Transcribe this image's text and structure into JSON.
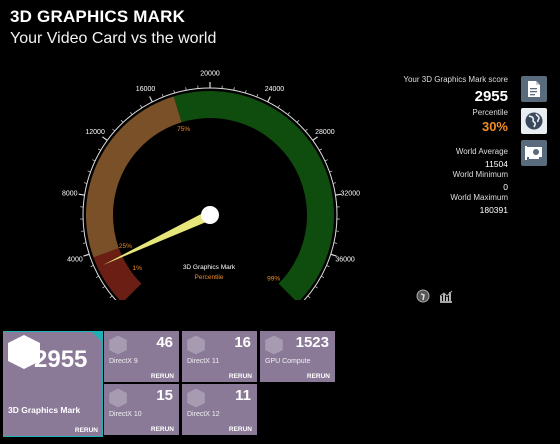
{
  "header": {
    "title": "3D GRAPHICS MARK",
    "subtitle": "Your Video Card vs the world"
  },
  "gauge": {
    "scale_labels": [
      "0",
      "4000",
      "8000",
      "12000",
      "16000",
      "20000",
      "24000",
      "28000",
      "32000",
      "36000",
      "40000"
    ],
    "scale_max": 40000,
    "score_value": 2955,
    "needle_value": 2955,
    "percentile_markers": [
      "1%",
      "25%",
      "75%",
      "99%"
    ],
    "center_title": "3D Graphics Mark",
    "center_subtitle": "Percentile",
    "colors": {
      "low": "#6b1f14",
      "mid": "#7a5028",
      "high": "#0f4d0f",
      "needle": "#e6e67a"
    }
  },
  "stats": {
    "score_label": "Your 3D Graphics Mark score",
    "score": "2955",
    "percentile_label": "Percentile",
    "percentile": "30%",
    "avg_label": "World Average",
    "avg": "11504",
    "min_label": "World Minimum",
    "min": "0",
    "max_label": "World Maximum",
    "max": "180391"
  },
  "side_buttons": [
    "report-icon",
    "globe-icon",
    "graphics-card-icon"
  ],
  "tools": [
    "info-icon",
    "chart-icon"
  ],
  "tiles": {
    "main": {
      "value": "2955",
      "name": "3D Graphics Mark",
      "rerun": "RERUN"
    },
    "dx9": {
      "value": "46",
      "name": "DirectX 9",
      "rerun": "RERUN"
    },
    "dx11": {
      "value": "16",
      "name": "DirectX 11",
      "rerun": "RERUN"
    },
    "gpu": {
      "value": "1523",
      "name": "GPU Compute",
      "rerun": "RERUN"
    },
    "dx10": {
      "value": "15",
      "name": "DirectX 10",
      "rerun": "RERUN"
    },
    "dx12": {
      "value": "11",
      "name": "DirectX 12",
      "rerun": "RERUN"
    }
  }
}
